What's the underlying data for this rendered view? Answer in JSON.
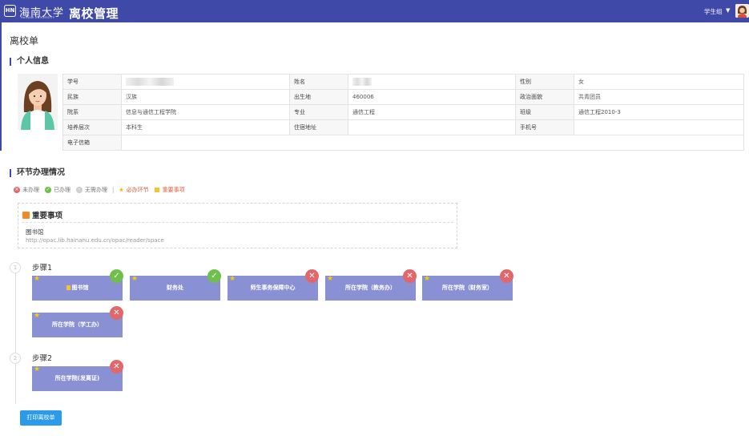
{
  "header": {
    "logo_badge": "HN",
    "logo_text": "海南大学",
    "logo_en": "HAINAN UNIVERSITY",
    "app_title": "离校管理",
    "role": "学生组",
    "colors": {
      "bar": "#3f4aa8"
    }
  },
  "page_title": "离校单",
  "personal": {
    "section_title": "个人信息",
    "rows": [
      [
        {
          "label": "学号",
          "value": ""
        },
        {
          "label": "姓名",
          "value": ""
        },
        {
          "label": "性别",
          "value": "女"
        }
      ],
      [
        {
          "label": "民族",
          "value": "汉族"
        },
        {
          "label": "出生地",
          "value": "460006"
        },
        {
          "label": "政治面貌",
          "value": "共青团员"
        }
      ],
      [
        {
          "label": "院系",
          "value": "信息与通信工程学院"
        },
        {
          "label": "专业",
          "value": "通信工程"
        },
        {
          "label": "班级",
          "value": "通信工程2010-3"
        }
      ],
      [
        {
          "label": "培养层次",
          "value": "本科生"
        },
        {
          "label": "住宿地址",
          "value": ""
        },
        {
          "label": "手机号",
          "value": ""
        }
      ],
      [
        {
          "label": "电子信箱",
          "value": ""
        }
      ]
    ]
  },
  "process": {
    "section_title": "环节办理情况",
    "legend": {
      "pending": "未办理",
      "done": "已办理",
      "not_needed": "无需办理",
      "separator": "|",
      "required": "必办环节",
      "important": "重要事项",
      "colors": {
        "pending": "#e2676a",
        "done": "#6fc04b",
        "not_needed": "#d0d0d0"
      }
    },
    "notice": {
      "title": "重要事项",
      "item": "图书馆",
      "url": "http://opac.lib.hainanu.edu.cn/opac/reader/space"
    },
    "steps": [
      {
        "number": "1",
        "label": "步骤1",
        "nodes": [
          {
            "name": "图书馆",
            "status": "done",
            "flag": true
          },
          {
            "name": "财务处",
            "status": "done",
            "flag": false
          },
          {
            "name": "师生事务保障中心",
            "status": "todo",
            "flag": false
          },
          {
            "name": "所在学院（教务办）",
            "status": "todo",
            "flag": false
          },
          {
            "name": "所在学院（财务室）",
            "status": "todo",
            "flag": false
          },
          {
            "name": "所在学院（学工办）",
            "status": "todo",
            "flag": false
          }
        ]
      },
      {
        "number": "2",
        "label": "步骤2",
        "nodes": [
          {
            "name": "所在学院(发离证)",
            "status": "todo",
            "flag": false
          }
        ]
      }
    ],
    "status_icons": {
      "done": "✓",
      "todo": "✕",
      "pending": "✕",
      "not_needed": "·"
    },
    "star": "★"
  },
  "actions": {
    "print_label": "打印离校单"
  }
}
